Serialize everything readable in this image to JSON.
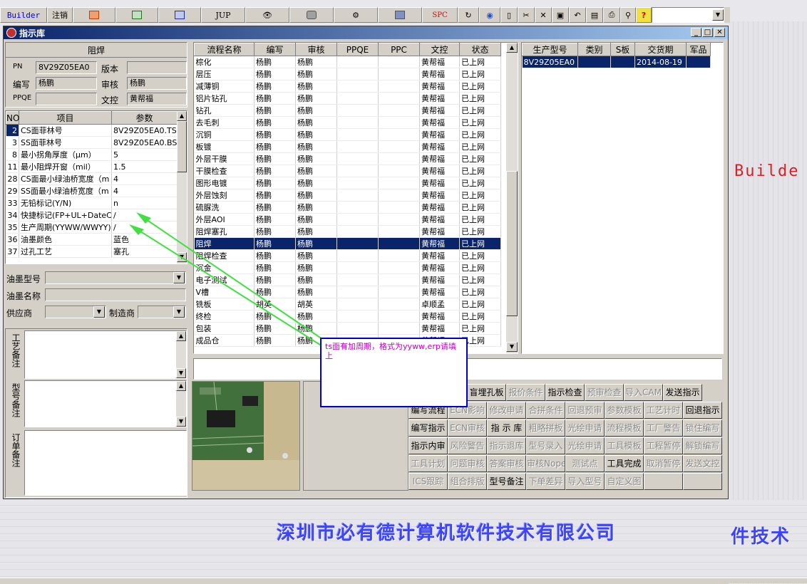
{
  "toolbar": {
    "builder": "Builder",
    "note": "注销",
    "jup": "JUP",
    "spc": "SPC"
  },
  "window": {
    "title": "指示库"
  },
  "background": {
    "builder_text": "Builde",
    "company": "深圳市必有德计算机软件技术有限公司",
    "company_partial": "件技术"
  },
  "left": {
    "section_title": "阻焊",
    "pn_label": "PN",
    "pn_value": "8V29Z05EA0",
    "version_label": "版本",
    "version_value": "",
    "editor_label": "编写",
    "editor_value": "杨鹏",
    "reviewer_label": "审核",
    "reviewer_value": "杨鹏",
    "ppqe_label": "PPQE",
    "ppqe_value": "",
    "wenkong_label": "文控",
    "wenkong_value": "黄帮福",
    "param_headers": {
      "no": "NO",
      "item": "项目",
      "param": "参数"
    },
    "params": [
      {
        "no": "2",
        "item": "CS面菲林号",
        "param": "8V29Z05EA0.TS"
      },
      {
        "no": "3",
        "item": "SS面菲林号",
        "param": "8V29Z05EA0.BS"
      },
      {
        "no": "8",
        "item": "最小拐角厚度（μm）",
        "param": "5"
      },
      {
        "no": "11",
        "item": "最小阻焊开窗（mil）",
        "param": "1.5"
      },
      {
        "no": "28",
        "item": "CS面最小绿油桥宽度（m",
        "param": "4"
      },
      {
        "no": "29",
        "item": "SS面最小绿油桥宽度（m",
        "param": "4"
      },
      {
        "no": "33",
        "item": "无铅标记(Y/N)",
        "param": "n"
      },
      {
        "no": "34",
        "item": "快捷标记(FP+UL+DateCo",
        "param": "/"
      },
      {
        "no": "35",
        "item": "生产周期(YYWW/WWYY)",
        "param": "/"
      },
      {
        "no": "36",
        "item": "油墨颜色",
        "param": "蓝色"
      },
      {
        "no": "37",
        "item": "过孔工艺",
        "param": "塞孔"
      }
    ],
    "ink_model_label": "油墨型号",
    "ink_name_label": "油墨名称",
    "supplier_label": "供应商",
    "maker_label": "制造商",
    "memo1": "工艺备注",
    "memo2": "型号备注",
    "memo3": "订单备注"
  },
  "flow": {
    "headers": [
      "流程名称",
      "编写",
      "审核",
      "PPQE",
      "PPC",
      "文控",
      "状态"
    ],
    "rows": [
      [
        "棕化",
        "杨鹏",
        "杨鹏",
        "",
        "",
        "黄帮福",
        "已上网"
      ],
      [
        "层压",
        "杨鹏",
        "杨鹏",
        "",
        "",
        "黄帮福",
        "已上网"
      ],
      [
        "减薄铜",
        "杨鹏",
        "杨鹏",
        "",
        "",
        "黄帮福",
        "已上网"
      ],
      [
        "铝片钻孔",
        "杨鹏",
        "杨鹏",
        "",
        "",
        "黄帮福",
        "已上网"
      ],
      [
        "钻孔",
        "杨鹏",
        "杨鹏",
        "",
        "",
        "黄帮福",
        "已上网"
      ],
      [
        "去毛刺",
        "杨鹏",
        "杨鹏",
        "",
        "",
        "黄帮福",
        "已上网"
      ],
      [
        "沉铜",
        "杨鹏",
        "杨鹏",
        "",
        "",
        "黄帮福",
        "已上网"
      ],
      [
        "板镀",
        "杨鹏",
        "杨鹏",
        "",
        "",
        "黄帮福",
        "已上网"
      ],
      [
        "外层干膜",
        "杨鹏",
        "杨鹏",
        "",
        "",
        "黄帮福",
        "已上网"
      ],
      [
        "干膜检查",
        "杨鹏",
        "杨鹏",
        "",
        "",
        "黄帮福",
        "已上网"
      ],
      [
        "图形电镀",
        "杨鹏",
        "杨鹏",
        "",
        "",
        "黄帮福",
        "已上网"
      ],
      [
        "外层蚀刻",
        "杨鹏",
        "杨鹏",
        "",
        "",
        "黄帮福",
        "已上网"
      ],
      [
        "硫脲洗",
        "杨鹏",
        "杨鹏",
        "",
        "",
        "黄帮福",
        "已上网"
      ],
      [
        "外层AOI",
        "杨鹏",
        "杨鹏",
        "",
        "",
        "黄帮福",
        "已上网"
      ],
      [
        "阻焊塞孔",
        "杨鹏",
        "杨鹏",
        "",
        "",
        "黄帮福",
        "已上网"
      ],
      [
        "阻焊",
        "杨鹏",
        "杨鹏",
        "",
        "",
        "黄帮福",
        "已上网"
      ],
      [
        "阻焊检查",
        "杨鹏",
        "杨鹏",
        "",
        "",
        "黄帮福",
        "已上网"
      ],
      [
        "沉金",
        "杨鹏",
        "杨鹏",
        "",
        "",
        "黄帮福",
        "已上网"
      ],
      [
        "电子测试",
        "杨鹏",
        "杨鹏",
        "",
        "",
        "黄帮福",
        "已上网"
      ],
      [
        "V槽",
        "杨鹏",
        "杨鹏",
        "",
        "",
        "黄帮福",
        "已上网"
      ],
      [
        "铣板",
        "胡英",
        "胡英",
        "",
        "",
        "卓顺孟",
        "已上网"
      ],
      [
        "终检",
        "杨鹏",
        "杨鹏",
        "",
        "",
        "黄帮福",
        "已上网"
      ],
      [
        "包装",
        "杨鹏",
        "杨鹏",
        "",
        "",
        "黄帮福",
        "已上网"
      ],
      [
        "成品仓",
        "杨鹏",
        "杨鹏",
        "",
        "",
        "黄帮福",
        "已上网"
      ]
    ],
    "selected_index": 15
  },
  "orders": {
    "headers": [
      "生产型号",
      "类别",
      "S板",
      "交货期",
      "军品"
    ],
    "rows": [
      [
        "8V29Z05EA0",
        "",
        "",
        "2014-08-19",
        ""
      ]
    ]
  },
  "popup": {
    "text": "ts面有加周期，格式为yyww,erp请填上"
  },
  "buttons": [
    [
      "",
      "",
      "",
      "ECN",
      "盲埋孔板",
      "报价条件",
      "指示检查",
      "预审检查",
      "导入CAM",
      "发送指示"
    ],
    [
      "编写流程",
      "ECN影响",
      "修改申请",
      "合拼条件",
      "回退预审",
      "参数模板",
      "工艺计时",
      "回退指示"
    ],
    [
      "编写指示",
      "ECN审核",
      "指 示 库",
      "粗略拼板",
      "光绘申请",
      "流程模板",
      "工厂警告",
      "锁住编写"
    ],
    [
      "指示内审",
      "风险警告",
      "指示退库",
      "型号录入",
      "光绘申请",
      "工具模板",
      "工程暂停",
      "解锁编写"
    ],
    [
      "工具计划",
      "问题审核",
      "答案审核",
      "审核Nope",
      "测试点",
      "工具完成",
      "取消暂停",
      "发送文控"
    ],
    [
      "ICS跟踪",
      "组合排版",
      "型号备注",
      "下单差异",
      "导入型号",
      "自定义图",
      "",
      ""
    ]
  ],
  "disabled_buttons": [
    "报价条件",
    "预审检查",
    "导入CAM",
    "ECN影响",
    "修改申请",
    "合拼条件",
    "回退预审",
    "参数模板",
    "工艺计时",
    "ECN审核",
    "粗略拼板",
    "光绘申请",
    "流程模板",
    "工厂警告",
    "锁住编写",
    "风险警告",
    "指示退库",
    "型号录入",
    "工具模板",
    "工程暂停",
    "解锁编写",
    "工具计划",
    "问题审核",
    "答案审核",
    "审核Nope",
    "测试点",
    "取消暂停",
    "发送文控",
    "ICS跟踪",
    "组合排版",
    "下单差异",
    "导入型号",
    "自定义图"
  ]
}
